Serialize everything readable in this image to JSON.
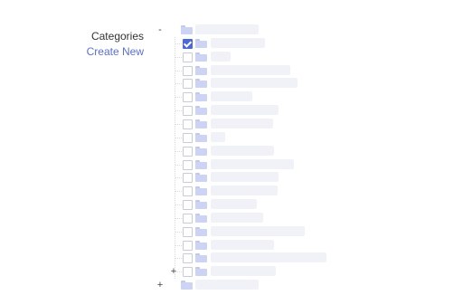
{
  "form": {
    "categories_label": "Categories",
    "create_new_link": "Create New"
  },
  "tree": {
    "root_toggle": "-",
    "expand_toggle": "+",
    "nodes": [
      {
        "depth": 0,
        "checked": false,
        "toggle": "-"
      },
      {
        "depth": 1,
        "checked": true
      },
      {
        "depth": 1,
        "checked": false
      },
      {
        "depth": 1,
        "checked": false
      },
      {
        "depth": 1,
        "checked": false
      },
      {
        "depth": 1,
        "checked": false
      },
      {
        "depth": 1,
        "checked": false
      },
      {
        "depth": 1,
        "checked": false
      },
      {
        "depth": 1,
        "checked": false
      },
      {
        "depth": 1,
        "checked": false
      },
      {
        "depth": 1,
        "checked": false
      },
      {
        "depth": 1,
        "checked": false
      },
      {
        "depth": 1,
        "checked": false
      },
      {
        "depth": 1,
        "checked": false
      },
      {
        "depth": 1,
        "checked": false
      },
      {
        "depth": 1,
        "checked": false
      },
      {
        "depth": 1,
        "checked": false
      },
      {
        "depth": 1,
        "checked": false
      },
      {
        "depth": 1,
        "checked": false,
        "toggle": "+"
      },
      {
        "depth": 0,
        "checked": false,
        "toggle": "+"
      }
    ]
  }
}
